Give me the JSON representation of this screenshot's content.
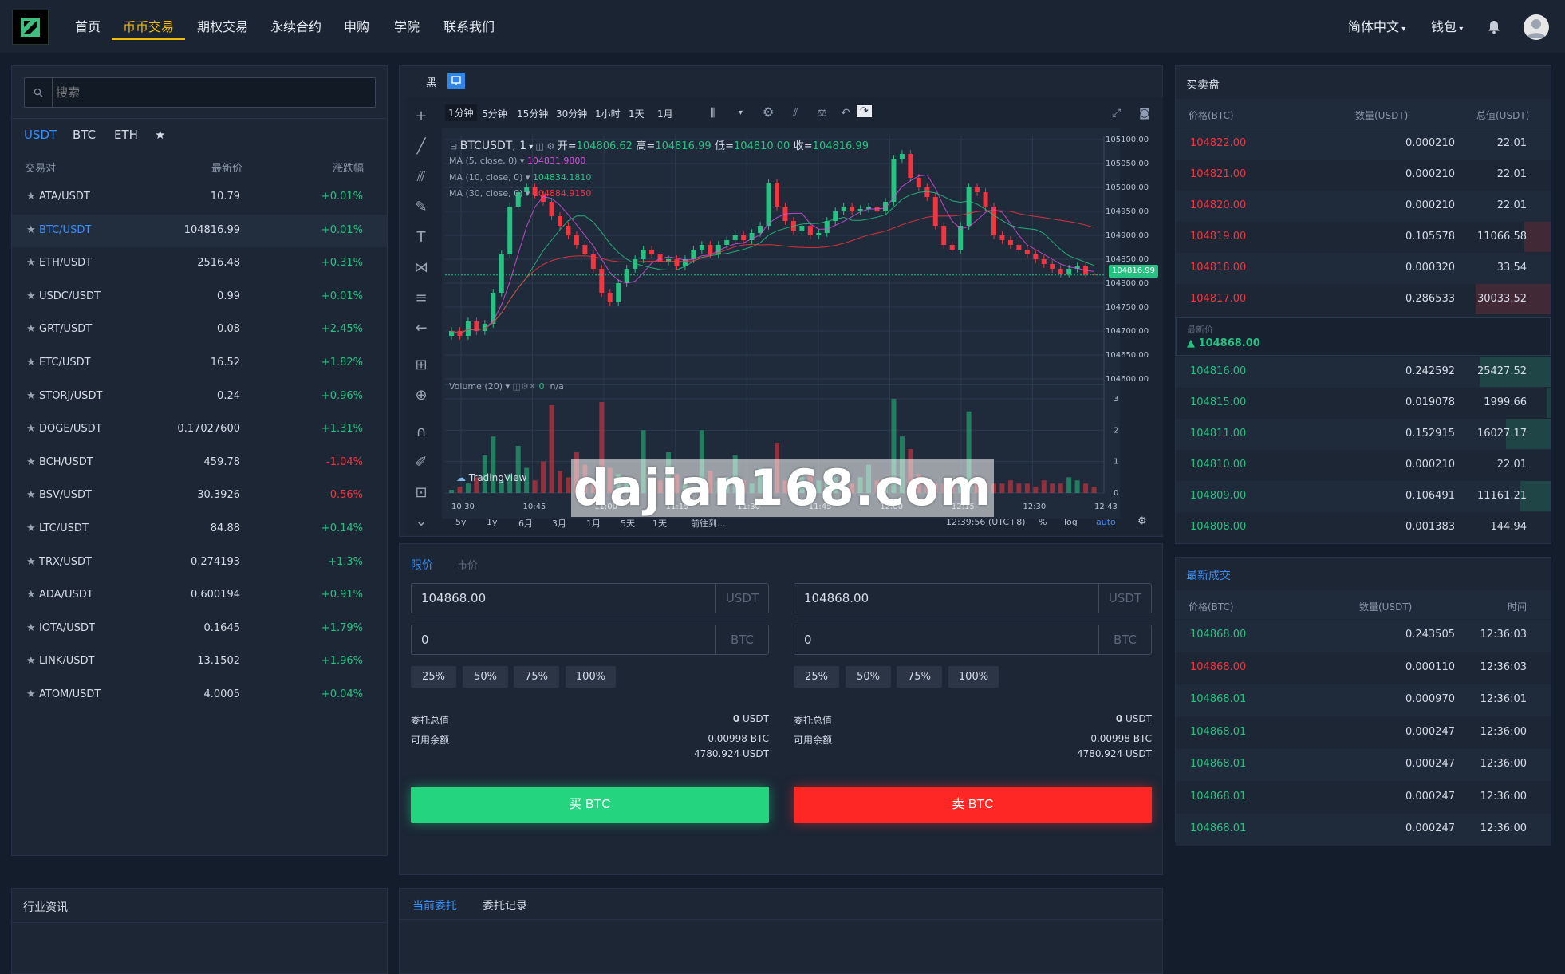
{
  "nav": {
    "items": [
      "首页",
      "币币交易",
      "期权交易",
      "永续合约",
      "申购",
      "学院",
      "联系我们"
    ],
    "active_index": 1,
    "language": "简体中文",
    "wallet": "钱包"
  },
  "market": {
    "search_placeholder": "搜索",
    "quote_tabs": [
      "USDT",
      "BTC",
      "ETH",
      "★"
    ],
    "active_tab": 0,
    "headers": {
      "pair": "交易对",
      "price": "最新价",
      "change": "涨跌幅"
    },
    "rows": [
      {
        "pair": "ATA/USDT",
        "price": "10.79",
        "change": "+0.01%",
        "dir": "up"
      },
      {
        "pair": "BTC/USDT",
        "price": "104816.99",
        "change": "+0.01%",
        "dir": "up"
      },
      {
        "pair": "ETH/USDT",
        "price": "2516.48",
        "change": "+0.31%",
        "dir": "up"
      },
      {
        "pair": "USDC/USDT",
        "price": "0.99",
        "change": "+0.01%",
        "dir": "up"
      },
      {
        "pair": "GRT/USDT",
        "price": "0.08",
        "change": "+2.45%",
        "dir": "up"
      },
      {
        "pair": "ETC/USDT",
        "price": "16.52",
        "change": "+1.82%",
        "dir": "up"
      },
      {
        "pair": "STORJ/USDT",
        "price": "0.24",
        "change": "+0.96%",
        "dir": "up"
      },
      {
        "pair": "DOGE/USDT",
        "price": "0.17027600",
        "change": "+1.31%",
        "dir": "up"
      },
      {
        "pair": "BCH/USDT",
        "price": "459.78",
        "change": "-1.04%",
        "dir": "down"
      },
      {
        "pair": "BSV/USDT",
        "price": "30.3926",
        "change": "-0.56%",
        "dir": "down"
      },
      {
        "pair": "LTC/USDT",
        "price": "84.88",
        "change": "+0.14%",
        "dir": "up"
      },
      {
        "pair": "TRX/USDT",
        "price": "0.274193",
        "change": "+1.3%",
        "dir": "up"
      },
      {
        "pair": "ADA/USDT",
        "price": "0.600194",
        "change": "+0.91%",
        "dir": "up"
      },
      {
        "pair": "IOTA/USDT",
        "price": "0.1645",
        "change": "+1.79%",
        "dir": "up"
      },
      {
        "pair": "LINK/USDT",
        "price": "13.1502",
        "change": "+1.96%",
        "dir": "up"
      },
      {
        "pair": "ATOM/USDT",
        "price": "4.0005",
        "change": "+0.04%",
        "dir": "up"
      }
    ],
    "selected_index": 1
  },
  "chart": {
    "theme_label": "黑",
    "timeframes": [
      "1分钟",
      "5分钟",
      "15分钟",
      "30分钟",
      "1小时",
      "1天",
      "1月"
    ],
    "active_timeframe": 0,
    "symbol": "BTCUSDT, 1",
    "ohlc": {
      "open_label": "开=",
      "open": "104806.62",
      "high_label": "高=",
      "high": "104816.99",
      "low_label": "低=",
      "low": "104810.00",
      "close_label": "收=",
      "close": "104816.99"
    },
    "ma5": {
      "label": "MA (5, close, 0)",
      "value": "104831.9800",
      "color": "#d64fdc"
    },
    "ma10": {
      "label": "MA (10, close, 0)",
      "value": "104834.1810",
      "color": "#26c281"
    },
    "ma30": {
      "label": "MA (30, close, 0)",
      "value": "104884.9150",
      "color": "#f2353f"
    },
    "volume_label": "Volume (20)",
    "volume_value": "0",
    "volume_na": "n/a",
    "tradingview": "TradingView",
    "current_price_tag": "104816.99",
    "bottom_periods": [
      "5y",
      "1y",
      "6月",
      "3月",
      "1月",
      "5天",
      "1天",
      "前往到..."
    ],
    "clock": "12:39:56 (UTC+8)",
    "scale_opts": [
      "%",
      "log",
      "auto"
    ]
  },
  "chart_data": {
    "type": "candlestick",
    "xlabel": "",
    "ylabel": "",
    "x_ticks": [
      "10:30",
      "10:45",
      "11:00",
      "11:15",
      "11:30",
      "11:45",
      "12:00",
      "12:15",
      "12:30",
      "12:43"
    ],
    "y_ticks": [
      105100,
      105050,
      105000,
      104950,
      104900,
      104850,
      104800,
      104750,
      104700,
      104650,
      104600
    ],
    "ylim": [
      104600,
      105100
    ],
    "volume_ticks": [
      0,
      1,
      2,
      3
    ],
    "volume_ylim": [
      0,
      3
    ],
    "close": [
      104700,
      104690,
      104720,
      104700,
      104715,
      104780,
      104860,
      104960,
      104990,
      105000,
      104985,
      104970,
      104940,
      104920,
      104900,
      104880,
      104860,
      104830,
      104780,
      104760,
      104800,
      104830,
      104850,
      104870,
      104860,
      104845,
      104850,
      104835,
      104850,
      104870,
      104880,
      104860,
      104880,
      104890,
      104900,
      104890,
      104905,
      104920,
      105010,
      104960,
      104930,
      104910,
      104920,
      104900,
      104905,
      104930,
      104950,
      104960,
      104950,
      104955,
      104960,
      104950,
      104970,
      105060,
      105070,
      105020,
      105000,
      104980,
      104920,
      104880,
      104870,
      104920,
      105000,
      104990,
      104960,
      104900,
      104890,
      104880,
      104870,
      104860,
      104850,
      104840,
      104830,
      104820,
      104830,
      104835,
      104820,
      104817
    ],
    "volume": [
      0.1,
      0.2,
      0.3,
      0.5,
      1.2,
      1.8,
      0.4,
      0.6,
      1.5,
      0.8,
      0.4,
      1.0,
      2.8,
      0.7,
      0.5,
      1.3,
      0.9,
      0.3,
      2.9,
      0.8,
      0.6,
      0.4,
      0.3,
      2.0,
      0.5,
      0.4,
      1.3,
      0.6,
      0.3,
      0.2,
      2.0,
      0.7,
      0.4,
      0.5,
      1.2,
      0.4,
      0.3,
      0.8,
      0.6,
      1.6,
      0.4,
      0.3,
      0.5,
      0.6,
      0.4,
      0.7,
      0.5,
      0.4,
      0.3,
      0.5,
      0.9,
      0.4,
      0.3,
      3.0,
      1.8,
      1.4,
      0.6,
      0.4,
      0.3,
      0.3,
      0.4,
      0.5,
      2.6,
      0.5,
      0.3,
      0.3,
      0.3,
      0.4,
      0.3,
      0.3,
      0.2,
      0.4,
      0.3,
      0.3,
      0.5,
      0.4,
      0.3,
      0.2
    ]
  },
  "trade": {
    "tabs": [
      "限价",
      "市价"
    ],
    "active_tab": 0,
    "buy": {
      "price": "104868.00",
      "price_unit": "USDT",
      "amount": "0",
      "amount_unit": "BTC",
      "button": "买 BTC"
    },
    "sell": {
      "price": "104868.00",
      "price_unit": "USDT",
      "amount": "0",
      "amount_unit": "BTC",
      "button": "卖 BTC"
    },
    "percents": [
      "25%",
      "50%",
      "75%",
      "100%"
    ],
    "total_label": "委托总值",
    "total_num": "0",
    "total_unit": "USDT",
    "avail_label": "可用余额",
    "avail_btc": "0.00998 BTC",
    "avail_usdt": "4780.924 USDT"
  },
  "orderbook": {
    "title": "买卖盘",
    "headers": {
      "price": "价格(BTC)",
      "qty": "数量(USDT)",
      "total": "总值(USDT)"
    },
    "asks": [
      {
        "price": "104822.00",
        "qty": "0.000210",
        "total": "22.01",
        "depth": 0.0
      },
      {
        "price": "104821.00",
        "qty": "0.000210",
        "total": "22.01",
        "depth": 0.0
      },
      {
        "price": "104820.00",
        "qty": "0.000210",
        "total": "22.01",
        "depth": 0.0
      },
      {
        "price": "104819.00",
        "qty": "0.105578",
        "total": "11066.58",
        "depth": 0.07
      },
      {
        "price": "104818.00",
        "qty": "0.000320",
        "total": "33.54",
        "depth": 0.0
      },
      {
        "price": "104817.00",
        "qty": "0.286533",
        "total": "30033.52",
        "depth": 0.2
      }
    ],
    "last_label": "最新价",
    "last_price": "104868.00",
    "bids": [
      {
        "price": "104816.00",
        "qty": "0.242592",
        "total": "25427.52",
        "depth": 0.19
      },
      {
        "price": "104815.00",
        "qty": "0.019078",
        "total": "1999.66",
        "depth": 0.01
      },
      {
        "price": "104811.00",
        "qty": "0.152915",
        "total": "16027.17",
        "depth": 0.12
      },
      {
        "price": "104810.00",
        "qty": "0.000210",
        "total": "22.01",
        "depth": 0.0
      },
      {
        "price": "104809.00",
        "qty": "0.106491",
        "total": "11161.21",
        "depth": 0.08
      },
      {
        "price": "104808.00",
        "qty": "0.001383",
        "total": "144.94",
        "depth": 0.0
      }
    ]
  },
  "trades": {
    "title": "最新成交",
    "headers": {
      "price": "价格(BTC)",
      "qty": "数量(USDT)",
      "time": "时间"
    },
    "rows": [
      {
        "price": "104868.00",
        "qty": "0.243505",
        "time": "12:36:03",
        "dir": "up"
      },
      {
        "price": "104868.00",
        "qty": "0.000110",
        "time": "12:36:03",
        "dir": "down"
      },
      {
        "price": "104868.01",
        "qty": "0.000970",
        "time": "12:36:01",
        "dir": "up"
      },
      {
        "price": "104868.01",
        "qty": "0.000247",
        "time": "12:36:00",
        "dir": "up"
      },
      {
        "price": "104868.01",
        "qty": "0.000247",
        "time": "12:36:00",
        "dir": "up"
      },
      {
        "price": "104868.01",
        "qty": "0.000247",
        "time": "12:36:00",
        "dir": "up"
      },
      {
        "price": "104868.01",
        "qty": "0.000247",
        "time": "12:36:00",
        "dir": "up"
      }
    ]
  },
  "news": {
    "title": "行业资讯"
  },
  "orders": {
    "tabs": [
      "当前委托",
      "委托记录"
    ],
    "active_tab": 0
  },
  "watermark": "dajian168.com",
  "colors": {
    "up": "#26c281",
    "down": "#f2353f",
    "accent": "#3c8ef5",
    "nav_active": "#f0b90b"
  }
}
